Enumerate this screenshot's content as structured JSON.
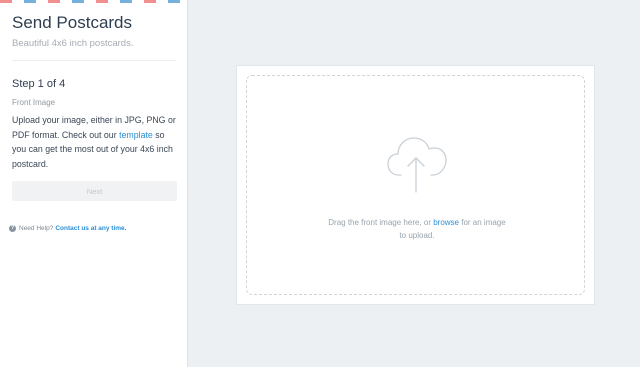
{
  "sidebar": {
    "title": "Send Postcards",
    "subtitle": "Beautiful 4x6 inch postcards.",
    "step_label": "Step 1 of 4",
    "step_sub": "Front Image",
    "instructions": {
      "before_link": "Upload your image, either in JPG, PNG or PDF format. Check out our ",
      "link": "template",
      "after_link": " so you can get the most out of your 4x6 inch postcard."
    },
    "next_label": "Next",
    "help": {
      "icon": "?",
      "text": "Need Help?",
      "link": "Contact us at any time."
    }
  },
  "dropzone": {
    "icon": "cloud-upload-icon",
    "text_before": "Drag the front image here, or ",
    "browse": "browse",
    "text_after": " for an image to upload."
  },
  "colors": {
    "airmail_red": "#f08f8f",
    "airmail_blue": "#76b0dd",
    "link": "#2b8fd6"
  }
}
